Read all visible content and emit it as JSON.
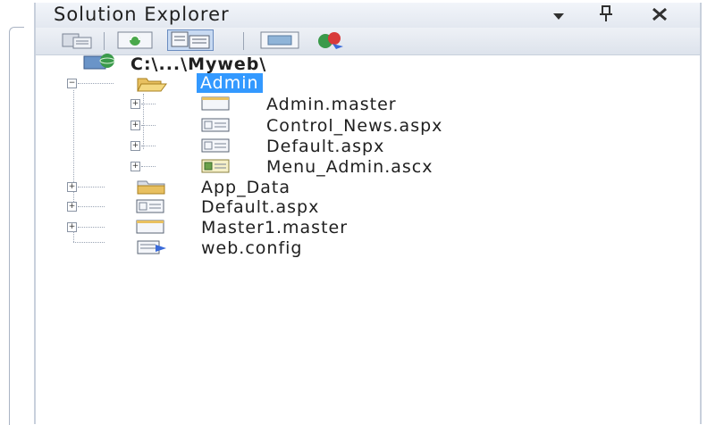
{
  "panel": {
    "title": "Solution Explorer",
    "buttons": {
      "dropdown_icon": "chevron-down-icon",
      "pin_icon": "pin-icon",
      "close_icon": "close-icon"
    }
  },
  "toolbar": {
    "icons": [
      "properties-icon",
      "refresh-icon",
      "show-all-files-icon",
      "view-designer-icon",
      "aspnet-configuration-icon"
    ]
  },
  "tree": {
    "root": {
      "label": "C:\\...\\Myweb\\",
      "icon": "website-icon"
    },
    "items": [
      {
        "label": "Admin",
        "icon": "folder-open-icon",
        "selected": true,
        "expanded": true,
        "children": [
          {
            "label": "Admin.master",
            "icon": "master-page-icon"
          },
          {
            "label": "Control_News.aspx",
            "icon": "aspx-page-icon"
          },
          {
            "label": "Default.aspx",
            "icon": "aspx-page-icon"
          },
          {
            "label": "Menu_Admin.ascx",
            "icon": "user-control-icon"
          }
        ]
      },
      {
        "label": "App_Data",
        "icon": "folder-icon"
      },
      {
        "label": "Default.aspx",
        "icon": "aspx-page-icon"
      },
      {
        "label": "Master1.master",
        "icon": "master-page-icon"
      },
      {
        "label": "web.config",
        "icon": "config-file-icon"
      }
    ]
  },
  "colors": {
    "selection": "#3399ff",
    "panel_border": "#c8d0dc",
    "title_bg": "#e8ecf2"
  }
}
